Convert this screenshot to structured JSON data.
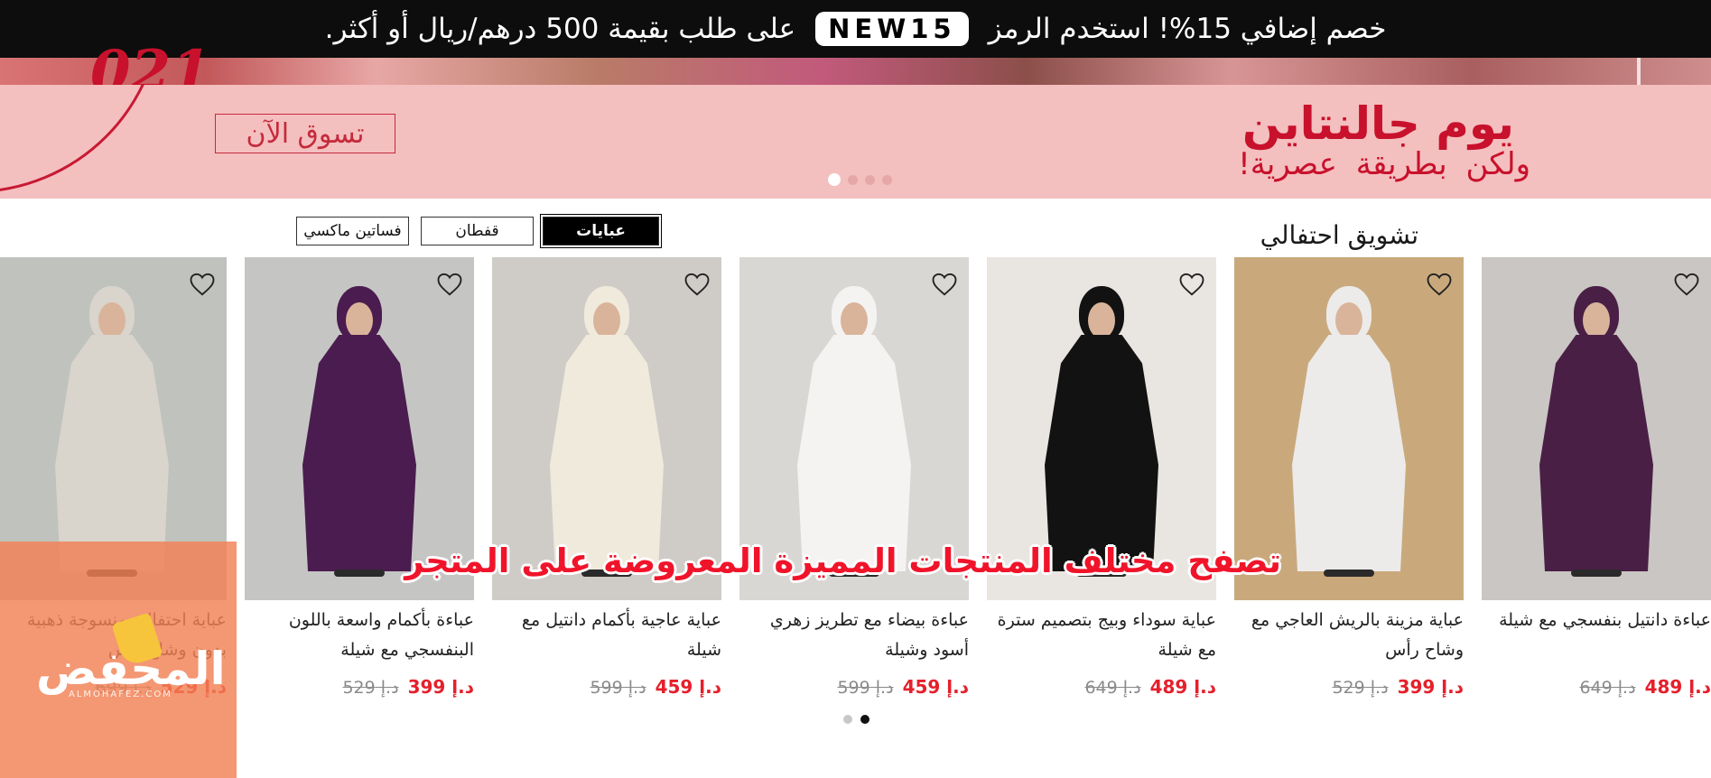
{
  "promo_bar": {
    "text_before": "خصم إضافي 15%! استخدم الرمز",
    "code": "NEW15",
    "text_after": "على طلب بقيمة 500 درهم/ريال أو أكثر."
  },
  "hero": {
    "year_fragment": "021"
  },
  "banner": {
    "title": "يوم جالنتاين",
    "subtitle": "ولكن بطريقة عصرية!",
    "cta_label": "تسوق الآن",
    "slide_count": 4,
    "active_slide": 1
  },
  "section": {
    "title": "تشويق احتفالي",
    "tabs": [
      {
        "label": "عبايات",
        "active": true
      },
      {
        "label": "قفطان",
        "active": false
      },
      {
        "label": "فساتين ماكسي",
        "active": false
      }
    ]
  },
  "products": [
    {
      "name": "عباءة دانتيل بنفسجي مع شيلة",
      "price_now": "د.إ 489",
      "price_was": "د.إ 649",
      "garment_color": "#4a1f45",
      "bg_color": "#c9c6c3"
    },
    {
      "name": "عباية مزينة بالريش العاجي مع وشاح رأس",
      "price_now": "د.إ 399",
      "price_was": "د.إ 529",
      "garment_color": "#ecebea",
      "bg_color": "#c9a97c"
    },
    {
      "name": "عباية سوداء وبيج بتصميم سترة مع شيلة",
      "price_now": "د.إ 489",
      "price_was": "د.إ 649",
      "garment_color": "#121212",
      "bg_color": "#e9e5e1"
    },
    {
      "name": "عباءة بيضاء مع تطريز زهري أسود وشيلة",
      "price_now": "د.إ 459",
      "price_was": "د.إ 599",
      "garment_color": "#f4f3f2",
      "bg_color": "#d9d7d4"
    },
    {
      "name": "عباية عاجية بأكمام دانتيل مع شيلة",
      "price_now": "د.إ 459",
      "price_was": "د.إ 599",
      "garment_color": "#f0eadc",
      "bg_color": "#cfccc8"
    },
    {
      "name": "عباءة بأكمام واسعة باللون البنفسجي مع شيلة",
      "price_now": "د.إ 399",
      "price_was": "د.إ 529",
      "garment_color": "#4b1c4f",
      "bg_color": "#c5c6c4"
    },
    {
      "name": "عباية احتفالية منسوجة ذهبية بدون وشاح رأس",
      "price_now": "د.إ 529",
      "price_was": "د.إ 699",
      "garment_color": "#d9d4cc",
      "bg_color": "#bfc2bd"
    }
  ],
  "carousel": {
    "page_count": 2,
    "active_page": 2
  },
  "overlay": {
    "caption": "تصفح مختلف المنتجات المميزة المعروضة على المتجر",
    "logo_text": "المحفض",
    "logo_subtext": "ALMOHAFEZ.COM"
  },
  "colors": {
    "promo_bg": "#0d0d0d",
    "banner_bg": "#f4bfbf",
    "banner_accent": "#c8112c",
    "price_red": "#e5202b",
    "logo_orange": "#f18054"
  }
}
